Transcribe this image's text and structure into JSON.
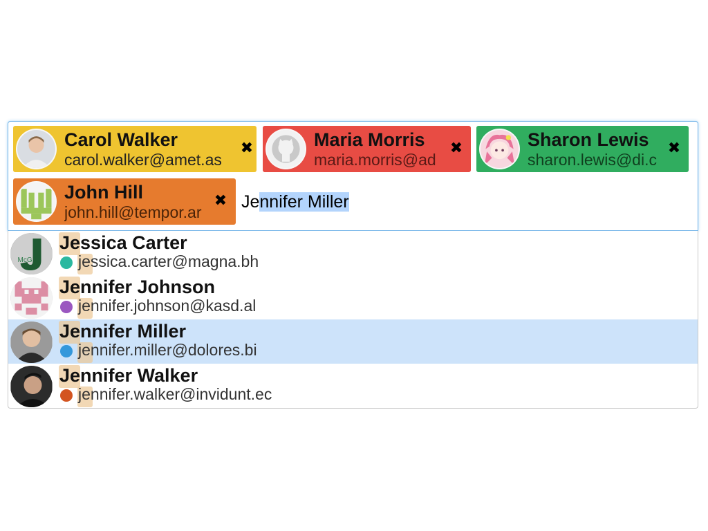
{
  "selected_tokens": [
    {
      "name": "Carol Walker",
      "email": "carol.walker@amet.as",
      "color": "#efc430",
      "email_color": "#222222",
      "avatar": "person-photo-avatar"
    },
    {
      "name": "Maria Morris",
      "email": "maria.morris@ad",
      "color": "#e84c44",
      "email_color": "#5a1a16",
      "avatar": "github-octocat-avatar"
    },
    {
      "name": "Sharon Lewis",
      "email": "sharon.lewis@di.c",
      "color": "#30ad5f",
      "email_color": "#10401f",
      "avatar": "anime-character-avatar"
    },
    {
      "name": "John Hill",
      "email": "john.hill@tempor.ar",
      "color": "#e67b2e",
      "email_color": "#4a2308",
      "avatar": "green-pattern-avatar"
    }
  ],
  "remove_glyph": "✖",
  "search": {
    "typed": "Je",
    "autocomplete": "nnifer Miller"
  },
  "suggestions": [
    {
      "name": "Jessica Carter",
      "email": "jessica.carter@magna.bh",
      "dot_color": "#2bb8a0",
      "avatar": "letter-j-avatar",
      "active": false
    },
    {
      "name": "Jennifer Johnson",
      "email": "jennifer.johnson@kasd.al",
      "dot_color": "#9a57c0",
      "avatar": "pink-identicon-avatar",
      "active": false
    },
    {
      "name": "Jennifer Miller",
      "email": "jennifer.miller@dolores.bi",
      "dot_color": "#3498db",
      "avatar": "person-photo-avatar",
      "active": true
    },
    {
      "name": "Jennifer Walker",
      "email": "jennifer.walker@invidunt.ec",
      "dot_color": "#d35420",
      "avatar": "person-photo-avatar",
      "active": false
    }
  ],
  "colors": {
    "focus_border": "#73b4e8",
    "active_row": "#cde3fa",
    "match_highlight": "#ecc896"
  }
}
